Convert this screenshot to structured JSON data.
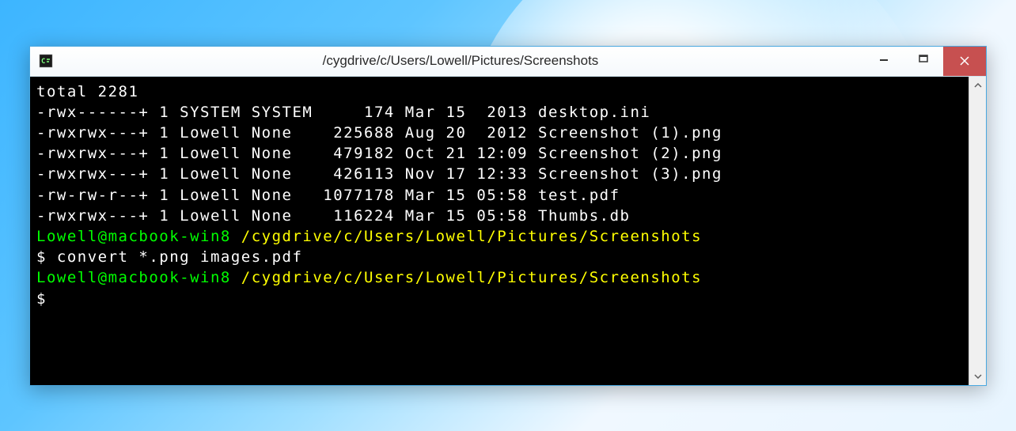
{
  "window": {
    "title": "/cygdrive/c/Users/Lowell/Pictures/Screenshots"
  },
  "terminal": {
    "totalLine": "total 2281",
    "files": [
      {
        "line": "-rwx------+ 1 SYSTEM SYSTEM     174 Mar 15  2013 desktop.ini"
      },
      {
        "line": "-rwxrwx---+ 1 Lowell None    225688 Aug 20  2012 Screenshot (1).png"
      },
      {
        "line": "-rwxrwx---+ 1 Lowell None    479182 Oct 21 12:09 Screenshot (2).png"
      },
      {
        "line": "-rwxrwx---+ 1 Lowell None    426113 Nov 17 12:33 Screenshot (3).png"
      },
      {
        "line": "-rw-rw-r--+ 1 Lowell None   1077178 Mar 15 05:58 test.pdf"
      },
      {
        "line": "-rwxrwx---+ 1 Lowell None    116224 Mar 15 05:58 Thumbs.db"
      }
    ],
    "prompt1": {
      "userhost": "Lowell@macbook-win8 ",
      "path": "/cygdrive/c/Users/Lowell/Pictures/Screenshots"
    },
    "command1": "$ convert *.png images.pdf",
    "prompt2": {
      "userhost": "Lowell@macbook-win8 ",
      "path": "/cygdrive/c/Users/Lowell/Pictures/Screenshots"
    },
    "command2": "$"
  }
}
